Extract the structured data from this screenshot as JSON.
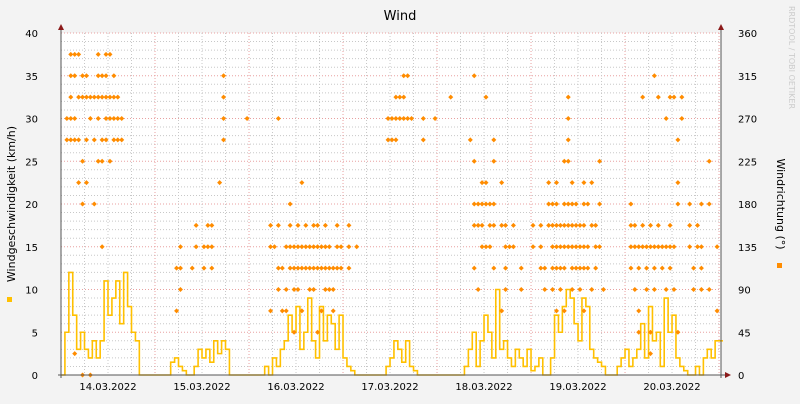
{
  "chart_data": {
    "type": "line",
    "title": "Wind",
    "ylabel": "Windgeschwindigkeit (km/h)",
    "y2label": "Windrichtung (°)",
    "watermark": "RRDTOOL / TOBI OETIKER",
    "ylim": [
      0,
      40
    ],
    "y2lim": [
      0,
      360
    ],
    "yticks": [
      "0",
      "5",
      "10",
      "15",
      "20",
      "25",
      "30",
      "35",
      "40"
    ],
    "y2ticks": [
      "0",
      "45",
      "90",
      "135",
      "180",
      "225",
      "270",
      "315",
      "360"
    ],
    "xrange_hours": [
      0,
      168.5
    ],
    "x_start": "13.03.2022 12:00",
    "xticks": [
      "14.03.2022",
      "15.03.2022",
      "16.03.2022",
      "17.03.2022",
      "18.03.2022",
      "19.03.2022",
      "20.03.2022"
    ],
    "grid": true,
    "colors": {
      "speed": "#FFC000",
      "direction": "#FF8C00",
      "major_grid": "#E8A0A0",
      "minor_grid": "#C8C8C8",
      "axis_arrow": "#8B1A1A"
    },
    "series": [
      {
        "name": "Windgeschwindigkeit",
        "axis": "left",
        "unit": "km/h",
        "hourly_values": [
          0,
          5,
          12,
          7,
          3,
          5,
          3,
          2,
          4,
          2,
          4,
          11,
          7,
          9,
          11,
          6,
          12,
          8,
          5,
          4,
          0,
          0,
          0,
          0,
          0,
          0,
          0,
          0,
          1.5,
          2,
          1,
          0.5,
          0,
          0,
          1,
          3,
          2,
          3,
          1.5,
          4,
          2.5,
          4,
          3,
          0,
          0,
          0,
          0,
          0,
          0,
          0,
          0,
          0,
          1,
          0,
          2,
          1,
          3,
          4,
          7,
          5,
          8,
          3,
          5,
          9,
          4,
          2,
          8,
          4,
          7,
          6,
          3,
          7,
          2,
          1,
          0.5,
          0,
          0,
          0,
          0,
          0,
          0,
          0,
          0,
          1,
          2,
          4,
          3,
          1.5,
          4,
          1,
          0.5,
          0,
          0,
          0,
          0,
          0,
          0,
          0,
          0,
          0,
          0,
          0,
          0,
          1,
          3,
          5,
          1,
          4,
          7,
          5,
          2,
          10,
          3,
          4,
          2,
          1,
          3,
          2,
          1,
          3,
          0.5,
          1,
          2,
          0,
          0,
          2,
          7,
          5,
          8,
          10,
          9,
          6,
          4,
          9,
          8,
          3,
          2,
          1.5,
          1,
          0,
          0,
          0,
          1,
          2,
          3,
          1,
          2,
          3,
          6,
          2,
          8,
          4,
          5,
          1,
          9,
          5,
          7,
          2,
          1,
          0.5,
          0,
          0,
          1,
          0,
          2,
          3,
          2,
          4,
          4
        ]
      },
      {
        "name": "Windrichtung",
        "axis": "right",
        "unit": "°",
        "points_by_hour": [
          [
            1,
            [
              270,
              247.5
            ]
          ],
          [
            2,
            [
              337.5,
              315,
              292.5,
              270,
              247.5
            ]
          ],
          [
            3,
            [
              337.5,
              315,
              270,
              247.5,
              22.5
            ]
          ],
          [
            4,
            [
              337.5,
              292.5,
              247.5,
              202.5
            ]
          ],
          [
            5,
            [
              315,
              292.5,
              225,
              180,
              0
            ]
          ],
          [
            6,
            [
              315,
              292.5,
              247.5,
              202.5
            ]
          ],
          [
            7,
            [
              292.5,
              270,
              0
            ]
          ],
          [
            8,
            [
              292.5,
              247.5,
              180
            ]
          ],
          [
            9,
            [
              337.5,
              315,
              292.5,
              270,
              225
            ]
          ],
          [
            10,
            [
              315,
              292.5,
              247.5,
              225,
              135
            ]
          ],
          [
            11,
            [
              337.5,
              315,
              292.5,
              270,
              247.5
            ]
          ],
          [
            12,
            [
              337.5,
              292.5,
              270,
              225
            ]
          ],
          [
            13,
            [
              315,
              292.5,
              270,
              247.5
            ]
          ],
          [
            14,
            [
              292.5,
              270,
              247.5
            ]
          ],
          [
            15,
            [
              270,
              247.5
            ]
          ],
          [
            29,
            [
              67.5,
              112.5
            ]
          ],
          [
            30,
            [
              90,
              135,
              112.5
            ]
          ],
          [
            33,
            [
              112.5
            ]
          ],
          [
            34,
            [
              135,
              157.5
            ]
          ],
          [
            36,
            [
              135,
              112.5
            ]
          ],
          [
            37,
            [
              135,
              157.5
            ]
          ],
          [
            38,
            [
              157.5,
              135,
              112.5
            ]
          ],
          [
            40,
            [
              202.5
            ]
          ],
          [
            41,
            [
              315,
              292.5,
              270,
              247.5
            ]
          ],
          [
            47,
            [
              270
            ]
          ],
          [
            55,
            [
              270
            ]
          ],
          [
            53,
            [
              157.5,
              135,
              67.5
            ]
          ],
          [
            54,
            [
              135
            ]
          ],
          [
            55,
            [
              112.5,
              157.5,
              90
            ]
          ],
          [
            56,
            [
              67.5,
              112.5
            ]
          ],
          [
            57,
            [
              135,
              90,
              67.5
            ]
          ],
          [
            58,
            [
              180,
              157.5,
              135,
              112.5
            ]
          ],
          [
            59,
            [
              135,
              112.5,
              90,
              45
            ]
          ],
          [
            60,
            [
              157.5,
              135,
              112.5,
              90
            ]
          ],
          [
            61,
            [
              202.5,
              135,
              112.5,
              67.5
            ]
          ],
          [
            62,
            [
              157.5,
              135,
              112.5
            ]
          ],
          [
            63,
            [
              135,
              112.5,
              90
            ]
          ],
          [
            64,
            [
              157.5,
              135,
              112.5,
              90
            ]
          ],
          [
            65,
            [
              157.5,
              135,
              112.5,
              45
            ]
          ],
          [
            66,
            [
              135,
              112.5,
              67.5
            ]
          ],
          [
            67,
            [
              157.5,
              135,
              112.5,
              90
            ]
          ],
          [
            68,
            [
              135,
              112.5,
              90
            ]
          ],
          [
            69,
            [
              112.5,
              90,
              67.5
            ]
          ],
          [
            70,
            [
              157.5,
              135,
              112.5
            ]
          ],
          [
            71,
            [
              135,
              112.5
            ]
          ],
          [
            73,
            [
              157.5,
              135,
              112.5
            ]
          ],
          [
            75,
            [
              135
            ]
          ],
          [
            83,
            [
              270,
              247.5
            ]
          ],
          [
            84,
            [
              270,
              247.5
            ]
          ],
          [
            85,
            [
              292.5,
              270,
              247.5
            ]
          ],
          [
            86,
            [
              292.5,
              270
            ]
          ],
          [
            87,
            [
              315,
              292.5,
              270
            ]
          ],
          [
            88,
            [
              315,
              270
            ]
          ],
          [
            89,
            [
              270
            ]
          ],
          [
            92,
            [
              270,
              247.5
            ]
          ],
          [
            95,
            [
              270
            ]
          ],
          [
            99,
            [
              292.5
            ]
          ],
          [
            105,
            [
              315
            ]
          ],
          [
            108,
            [
              292.5
            ]
          ],
          [
            104,
            [
              247.5
            ]
          ],
          [
            105,
            [
              225,
              180,
              157.5,
              112.5
            ]
          ],
          [
            106,
            [
              180,
              157.5,
              90
            ]
          ],
          [
            107,
            [
              202.5,
              180,
              157.5,
              135
            ]
          ],
          [
            108,
            [
              202.5,
              180,
              135
            ]
          ],
          [
            109,
            [
              180,
              157.5,
              135
            ]
          ],
          [
            110,
            [
              247.5,
              225,
              180,
              157.5,
              112.5
            ]
          ],
          [
            112,
            [
              202.5,
              157.5,
              67.5
            ]
          ],
          [
            113,
            [
              157.5,
              135,
              112.5,
              90
            ]
          ],
          [
            114,
            [
              135
            ]
          ],
          [
            115,
            [
              157.5,
              135
            ]
          ],
          [
            117,
            [
              112.5,
              90
            ]
          ],
          [
            120,
            [
              157.5,
              135
            ]
          ],
          [
            122,
            [
              157.5,
              135,
              112.5
            ]
          ],
          [
            123,
            [
              112.5,
              90
            ]
          ],
          [
            124,
            [
              202.5,
              180,
              157.5
            ]
          ],
          [
            125,
            [
              180,
              157.5,
              135,
              112.5,
              90
            ]
          ],
          [
            126,
            [
              202.5,
              180,
              157.5,
              135,
              112.5,
              67.5
            ]
          ],
          [
            127,
            [
              157.5,
              135,
              112.5,
              90
            ]
          ],
          [
            128,
            [
              225,
              180,
              157.5,
              135,
              112.5,
              67.5
            ]
          ],
          [
            129,
            [
              292.5,
              270,
              247.5,
              225,
              180,
              157.5,
              135
            ]
          ],
          [
            130,
            [
              202.5,
              180,
              157.5,
              135,
              112.5,
              90
            ]
          ],
          [
            131,
            [
              180,
              157.5,
              135,
              112.5
            ]
          ],
          [
            132,
            [
              157.5,
              135,
              112.5,
              90
            ]
          ],
          [
            133,
            [
              202.5,
              180,
              157.5,
              135,
              112.5,
              67.5
            ]
          ],
          [
            134,
            [
              180,
              135,
              112.5
            ]
          ],
          [
            135,
            [
              202.5,
              157.5,
              90
            ]
          ],
          [
            136,
            [
              157.5,
              135,
              112.5
            ]
          ],
          [
            137,
            [
              225,
              180,
              135
            ]
          ],
          [
            138,
            [
              90
            ]
          ],
          [
            145,
            [
              180,
              157.5,
              135,
              112.5
            ]
          ],
          [
            146,
            [
              157.5,
              135,
              90
            ]
          ],
          [
            147,
            [
              135,
              112.5,
              67.5,
              45
            ]
          ],
          [
            148,
            [
              292.5,
              157.5,
              135
            ]
          ],
          [
            149,
            [
              135,
              112.5,
              90
            ]
          ],
          [
            150,
            [
              157.5,
              135,
              45,
              22.5
            ]
          ],
          [
            151,
            [
              315,
              135,
              112.5,
              90
            ]
          ],
          [
            152,
            [
              292.5,
              157.5,
              135
            ]
          ],
          [
            153,
            [
              135,
              112.5
            ]
          ],
          [
            154,
            [
              270,
              135,
              90
            ]
          ],
          [
            155,
            [
              292.5,
              157.5,
              135,
              112.5
            ]
          ],
          [
            156,
            [
              292.5,
              135,
              90
            ]
          ],
          [
            157,
            [
              247.5,
              202.5,
              180,
              45
            ]
          ],
          [
            158,
            [
              292.5,
              270
            ]
          ],
          [
            160,
            [
              180,
              157.5,
              135
            ]
          ],
          [
            161,
            [
              112.5,
              90
            ]
          ],
          [
            162,
            [
              157.5,
              135
            ]
          ],
          [
            163,
            [
              180,
              135,
              112.5,
              90
            ]
          ],
          [
            165,
            [
              225,
              180,
              90
            ]
          ],
          [
            167,
            [
              135,
              67.5
            ]
          ]
        ]
      }
    ]
  }
}
